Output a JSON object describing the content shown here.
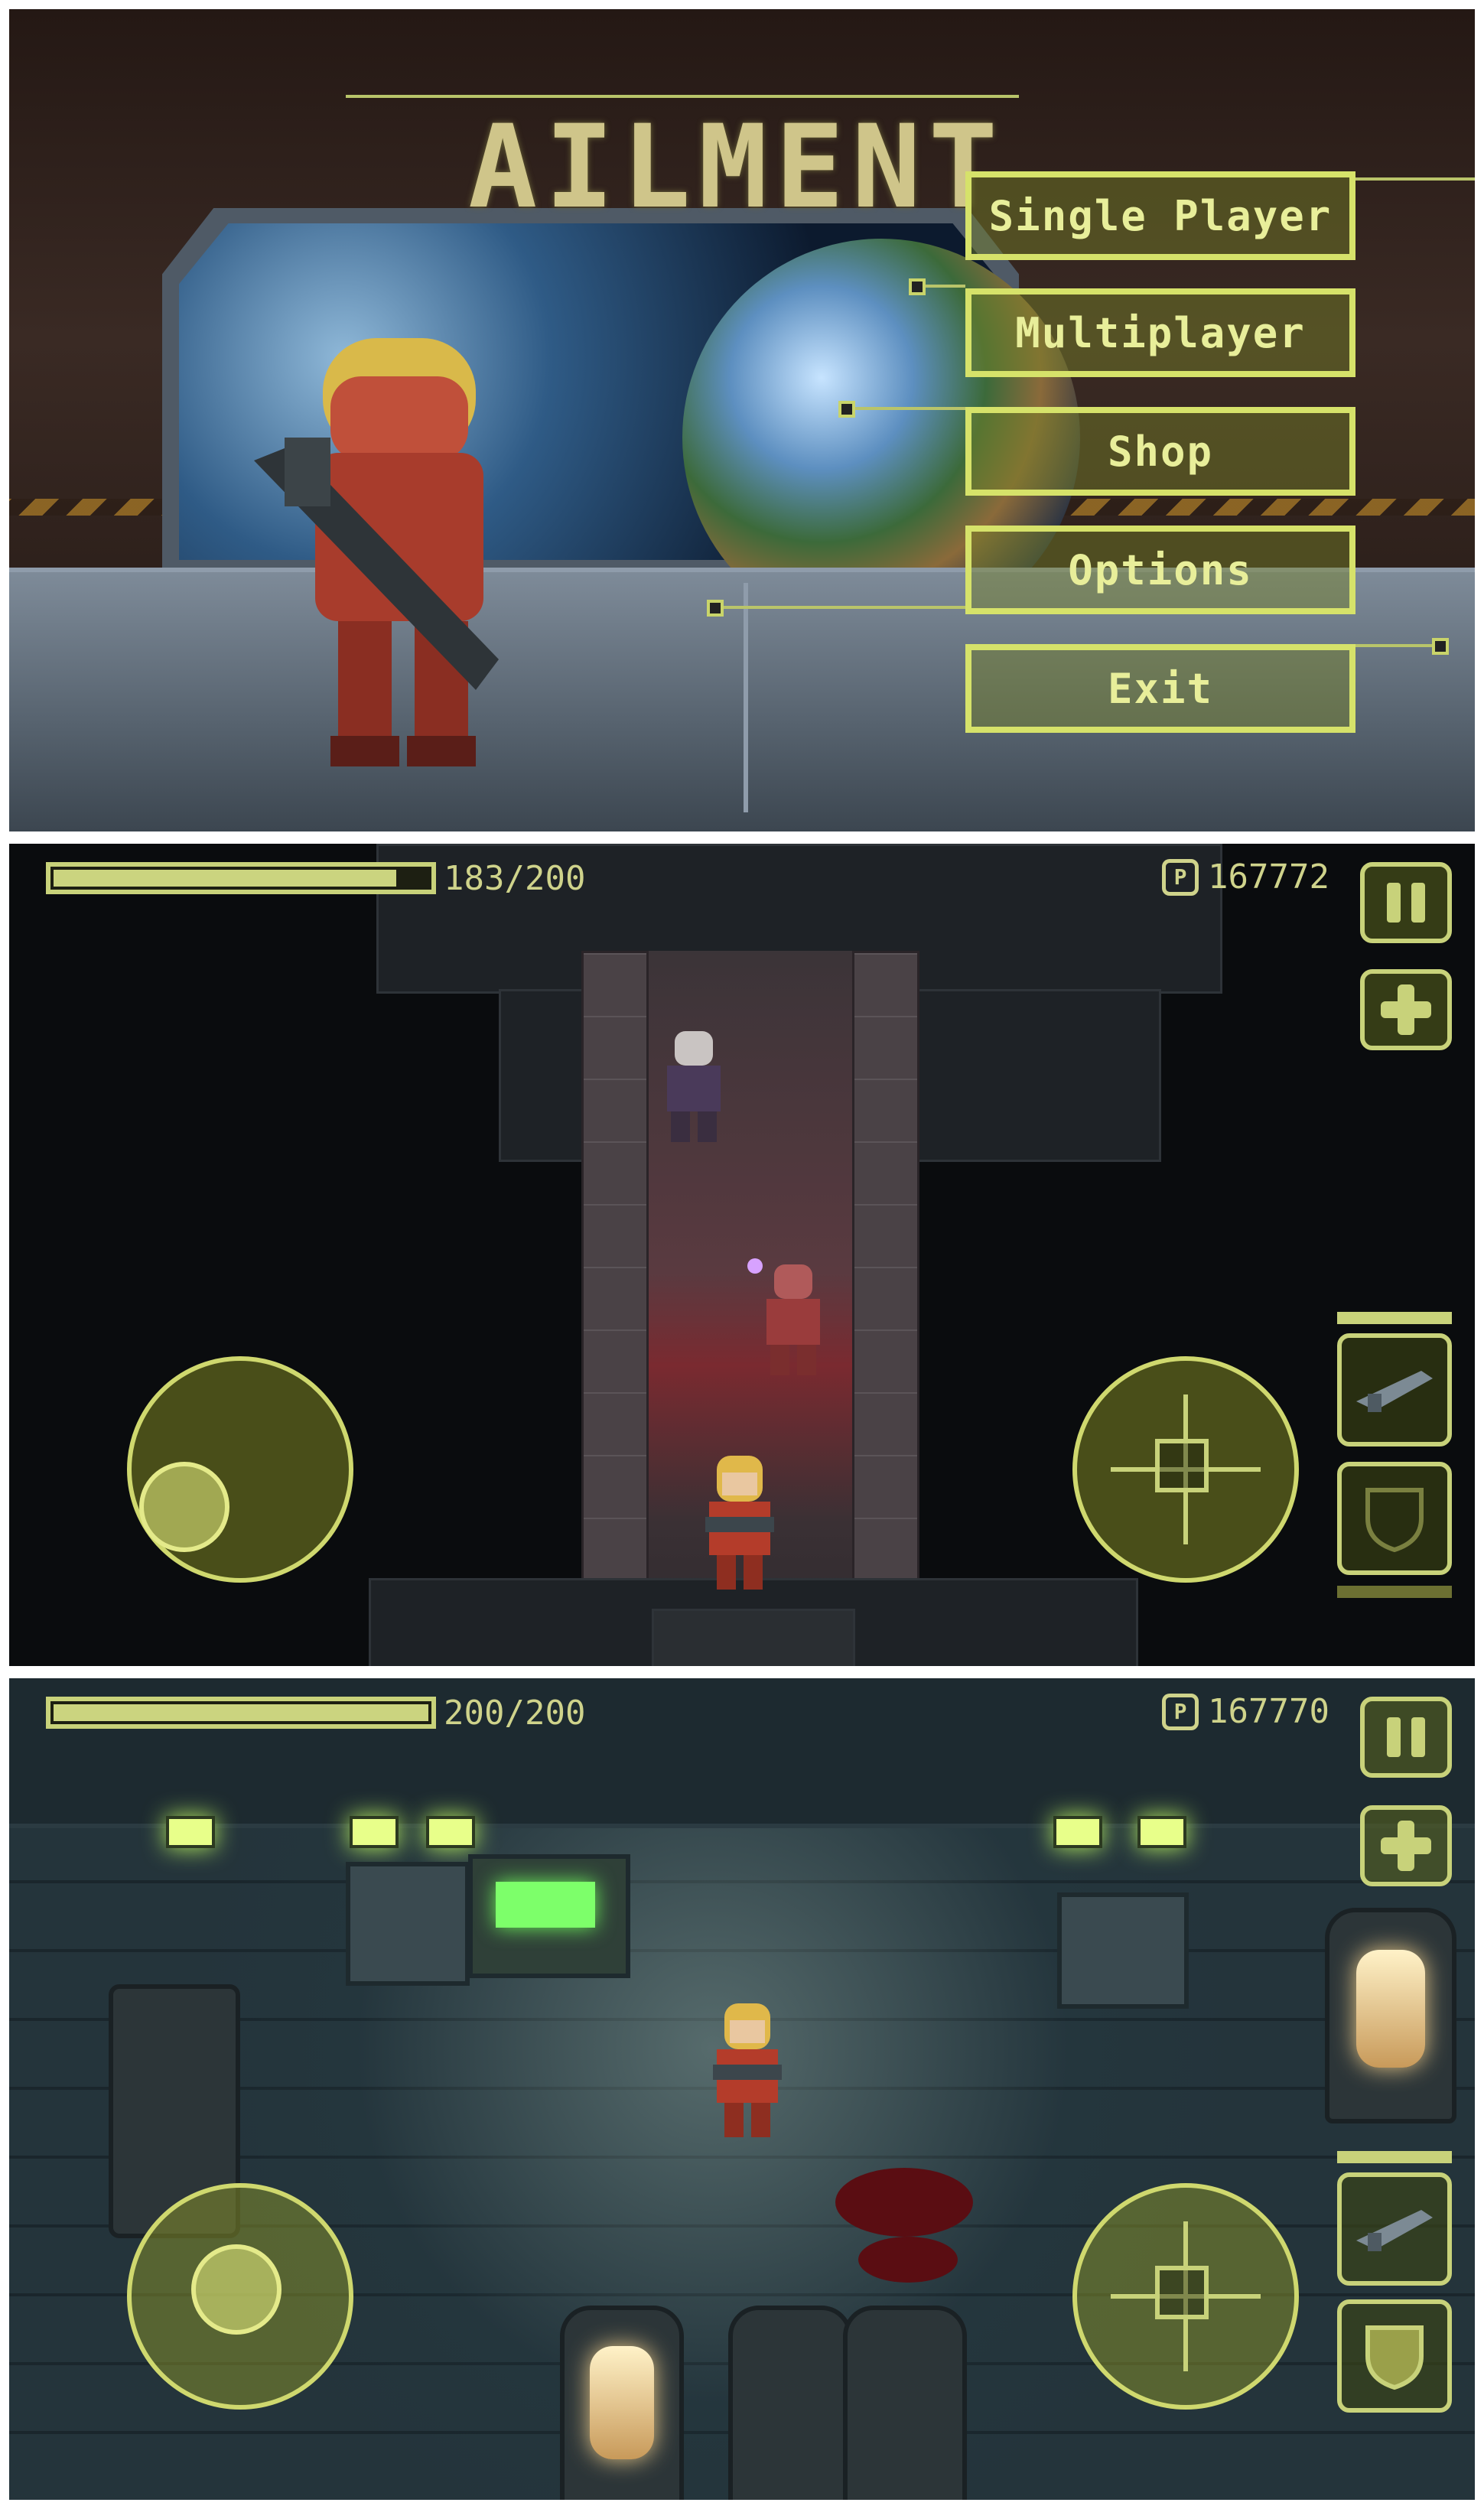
{
  "menu": {
    "title": "AILMENT",
    "buttons": [
      "Single Player",
      "Multiplayer",
      "Shop",
      "Options",
      "Exit"
    ]
  },
  "screen1": {
    "hp_text": "183/200",
    "hp": {
      "current": 183,
      "max": 200
    },
    "points": "167772",
    "points_icon": "P"
  },
  "screen2": {
    "hp_text": "200/200",
    "hp": {
      "current": 200,
      "max": 200
    },
    "points": "167770",
    "points_icon": "P"
  },
  "colors": {
    "hud_accent": "#c8d27a",
    "menu_accent": "#d6e26a"
  },
  "icons": {
    "pause": "pause-icon",
    "heal": "plus-icon",
    "weapon": "rifle-icon",
    "shield": "shield-icon",
    "aim": "crosshair-icon"
  }
}
